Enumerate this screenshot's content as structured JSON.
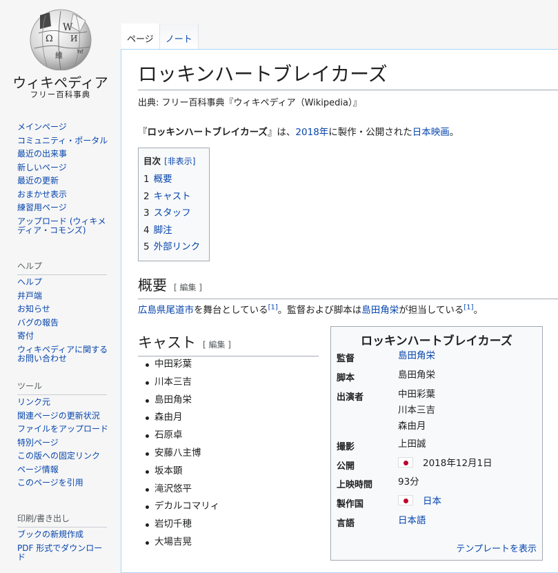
{
  "sidebar": {
    "wordmark": "ウィキペディア",
    "tagline": "フリー百科事典",
    "nav_items": [
      {
        "label": "メインページ"
      },
      {
        "label": "コミュニティ・ポータル"
      },
      {
        "label": "最近の出来事"
      },
      {
        "label": "新しいページ"
      },
      {
        "label": "最近の更新"
      },
      {
        "label": "おまかせ表示"
      },
      {
        "label": "練習用ページ"
      },
      {
        "label": "アップロード (ウィキメディア・コモンズ)"
      }
    ],
    "help_heading": "ヘルプ",
    "help_items": [
      {
        "label": "ヘルプ"
      },
      {
        "label": "井戸端"
      },
      {
        "label": "お知らせ"
      },
      {
        "label": "バグの報告"
      },
      {
        "label": "寄付"
      },
      {
        "label": "ウィキペディアに関するお問い合わせ"
      }
    ],
    "tools_heading": "ツール",
    "tools_items": [
      {
        "label": "リンク元"
      },
      {
        "label": "関連ページの更新状況"
      },
      {
        "label": "ファイルをアップロード"
      },
      {
        "label": "特別ページ"
      },
      {
        "label": "この版への固定リンク"
      },
      {
        "label": "ページ情報"
      },
      {
        "label": "このページを引用"
      }
    ],
    "print_heading": "印刷/書き出し",
    "print_items": [
      {
        "label": "ブックの新規作成"
      },
      {
        "label": "PDF 形式でダウンロード"
      }
    ]
  },
  "tabs": {
    "page": "ページ",
    "talk": "ノート"
  },
  "article": {
    "title": "ロッキンハートブレイカーズ",
    "site_sub": "出典: フリー百科事典『ウィキペディア（Wikipedia）』",
    "lead": {
      "open_quote": "『",
      "bold_title": "ロッキンハートブレイカーズ",
      "close_quote": "』は、",
      "year_link": "2018年",
      "mid": "に製作・公開された",
      "film_link": "日本映画",
      "end": "。"
    },
    "toc": {
      "title": "目次",
      "toggle": "[非表示]",
      "items": [
        {
          "num": "1",
          "label": "概要"
        },
        {
          "num": "2",
          "label": "キャスト"
        },
        {
          "num": "3",
          "label": "スタッフ"
        },
        {
          "num": "4",
          "label": "脚注"
        },
        {
          "num": "5",
          "label": "外部リンク"
        }
      ]
    },
    "overview": {
      "heading": "概要",
      "edit": "[ 編集 ]",
      "place_link": "広島県",
      "place_link2": "尾道市",
      "text1": "を舞台としている",
      "ref1": "[1]",
      "text2": "。監督および脚本は",
      "director_link": "島田角栄",
      "text3": "が担当している",
      "ref2": "[1]",
      "text4": "。"
    },
    "cast": {
      "heading": "キャスト",
      "edit": "[ 編集 ]",
      "members": [
        "中田彩葉",
        "川本三吉",
        "島田角栄",
        "森由月",
        "石原卓",
        "安藤八主博",
        "坂本顕",
        "滝沢悠平",
        "デカルコマリィ",
        "岩切千穂",
        "大場吉晃"
      ]
    }
  },
  "infobox": {
    "title": "ロッキンハートブレイカーズ",
    "director_label": "監督",
    "director": "島田角栄",
    "writer_label": "脚本",
    "writer": "島田角栄",
    "starring_label": "出演者",
    "starring": [
      "中田彩葉",
      "川本三吉",
      "森由月"
    ],
    "cinematography_label": "撮影",
    "cinematography": "上田誠",
    "release_label": "公開",
    "release": "2018年12月1日",
    "runtime_label": "上映時間",
    "runtime": "93分",
    "country_label": "製作国",
    "country": "日本",
    "language_label": "言語",
    "language": "日本語",
    "template_link": "テンプレートを表示",
    "flag_color": "#bc002d"
  }
}
